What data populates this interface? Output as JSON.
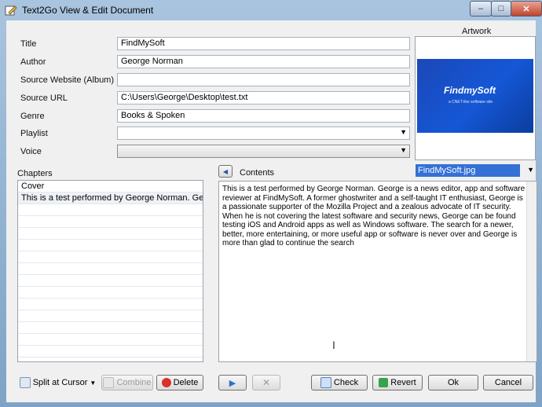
{
  "window": {
    "title": "Text2Go View & Edit Document",
    "minimize": "‒",
    "maximize": "□",
    "close": "✕"
  },
  "form": {
    "labels": {
      "title": "Title",
      "author": "Author",
      "source_website": "Source Website (Album)",
      "source_url": "Source URL",
      "genre": "Genre",
      "playlist": "Playlist",
      "voice": "Voice"
    },
    "values": {
      "title": "FindMySoft",
      "author": "George Norman",
      "source_website": "",
      "source_url": "C:\\Users\\George\\Desktop\\test.txt",
      "genre": "Books & Spoken",
      "playlist": "",
      "voice": ""
    }
  },
  "artwork": {
    "label": "Artwork",
    "brand": "FindmySoft",
    "tagline": "a CNET-like software site",
    "file": "FindMySoft.jpg"
  },
  "chapters": {
    "label": "Chapters",
    "items": [
      "Cover",
      "This is a test performed by George Norman. George is ..."
    ]
  },
  "contents": {
    "label": "Contents",
    "text": "This is a test performed by George Norman. George is a news editor, app and software reviewer at FindMySoft. A former ghostwriter and a self-taught IT enthusiast, George is a passionate supporter of the Mozilla Project and a zealous advocate of IT security. When he is not covering the latest software and security news, George can be found testing iOS and Android apps as well as Windows software. The search for a newer, better, more entertaining, or more useful app or software is never over and George is more than glad to continue the search"
  },
  "buttons": {
    "split": "Split at Cursor",
    "combine": "Combine",
    "delete": "Delete",
    "check": "Check",
    "revert": "Revert",
    "ok": "Ok",
    "cancel": "Cancel"
  },
  "colors": {
    "selection": "#3470d6",
    "artwork_bg": "#1557d6",
    "window_frame": "#7ea3c6"
  }
}
